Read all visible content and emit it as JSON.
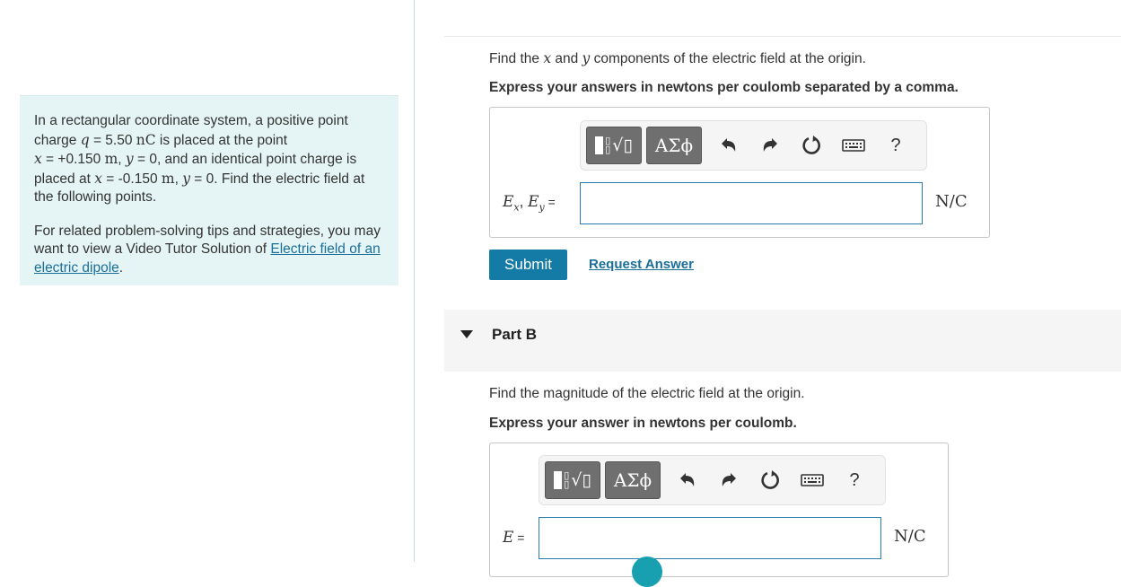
{
  "problem": {
    "p1": {
      "a": "In a rectangular coordinate system, a positive point charge ",
      "q": "q",
      "b": " = 5.50 ",
      "nC": "nC",
      "c": " is placed at the point",
      "x1": "x",
      "d": " = +0.150 ",
      "m1": "m",
      "e": ", ",
      "y1": "y",
      "f": " = 0, and an identical point charge is placed at ",
      "x2": "x",
      "g": " = -0.150 ",
      "m2": "m",
      "h": ", ",
      "y2": "y",
      "i": " = 0. Find the electric field at the following points."
    },
    "p2": {
      "text": "For related problem-solving tips and strategies, you may want to view a Video Tutor Solution of ",
      "link": "Electric field of an electric dipole",
      "end": "."
    }
  },
  "partA": {
    "q_pre": "Find the ",
    "q_x": "x",
    "q_mid": " and ",
    "q_y": "y",
    "q_post": " components of the electric field at the origin.",
    "instruction": "Express your answers in newtons per coulomb separated by a comma.",
    "label_e1": "E",
    "label_sub1": "x",
    "label_sep": ", ",
    "label_e2": "E",
    "label_sub2": "y",
    "label_eq": " =",
    "input_value": "",
    "unit": "N/C",
    "submit": "Submit",
    "request": "Request Answer"
  },
  "partB": {
    "title": "Part B",
    "question": "Find the magnitude of the electric field at the origin.",
    "instruction": "Express your answer in newtons per coulomb.",
    "label_e": "E",
    "label_eq": " =",
    "input_value": "",
    "unit": "N/C"
  },
  "toolbar": {
    "symbols": "ΑΣϕ",
    "templates_icon": "templates-icon",
    "undo_icon": "undo-icon",
    "redo_icon": "redo-icon",
    "reset_icon": "reset-icon",
    "keyboard_icon": "keyboard-icon",
    "help": "?"
  },
  "colors": {
    "panel_bg": "#e5f5f5",
    "submit_bg": "#137ba6",
    "link": "#1a6f9a",
    "input_border": "#2b7bb0"
  }
}
